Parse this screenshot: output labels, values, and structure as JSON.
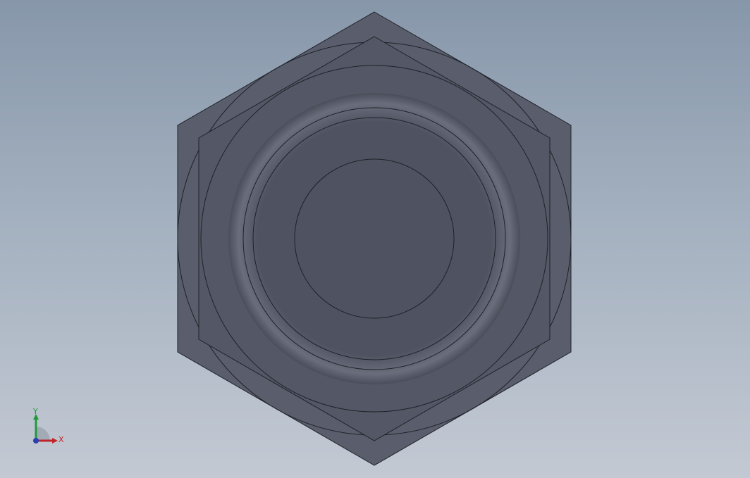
{
  "viewport": {
    "background_top": "#8797aa",
    "background_bottom": "#c3c9d3"
  },
  "model": {
    "name": "hex-nut-with-flange",
    "view": "front",
    "face_color_outer": "#585c6a",
    "face_color_inner": "#4f5360",
    "edge_color": "#1e2128",
    "hole_color": "#a3b0bf"
  },
  "triad": {
    "x_label": "X",
    "y_label": "Y",
    "x_color": "#c0242a",
    "y_color": "#1f9a3a",
    "z_color": "#2a3fb0"
  }
}
